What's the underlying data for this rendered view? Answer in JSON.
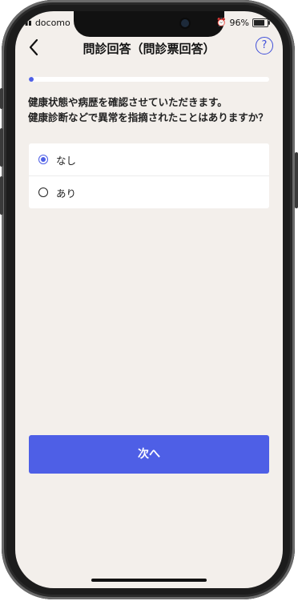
{
  "status_bar": {
    "carrier": "docomo",
    "battery": "96%",
    "battery_level": 0.96
  },
  "header": {
    "back_icon": "chevron-left-icon",
    "title": "問診回答（問診票回答）",
    "help_label": "?"
  },
  "progress": {
    "fraction": 0.02
  },
  "question": {
    "text": "健康状態や病歴を確認させていただきます。\n健康診断などで異常を指摘されたことはありますか？"
  },
  "options": [
    {
      "label": "なし",
      "selected": true
    },
    {
      "label": "あり",
      "selected": false
    }
  ],
  "actions": {
    "next_label": "次へ"
  },
  "colors": {
    "accent": "#4e5fe6",
    "background": "#f3efeb"
  }
}
